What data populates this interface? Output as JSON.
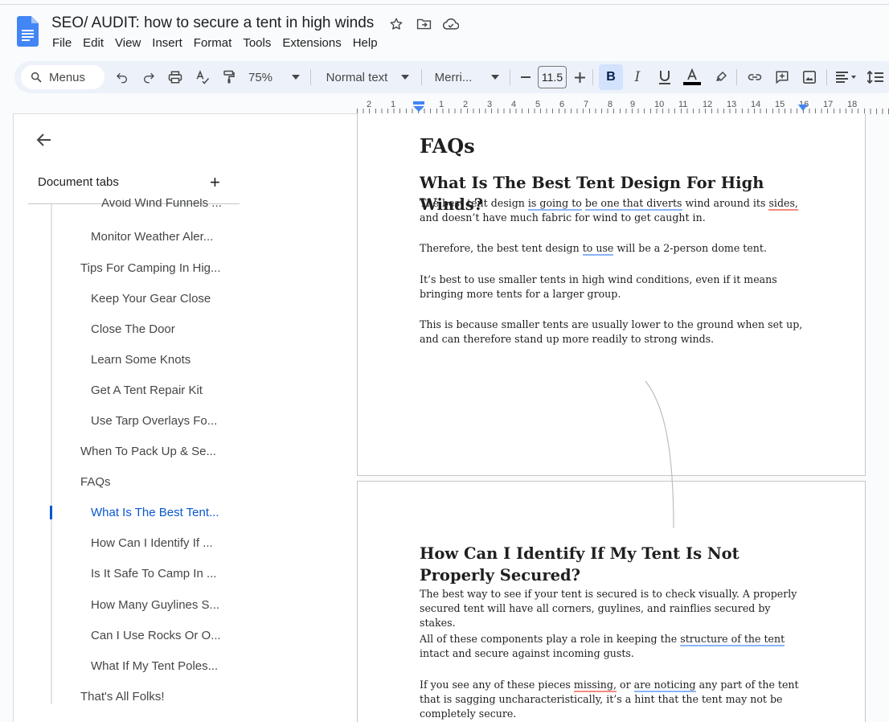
{
  "doc": {
    "title": "SEO/ AUDIT: how to secure a tent in high winds",
    "menus": [
      "File",
      "Edit",
      "View",
      "Insert",
      "Format",
      "Tools",
      "Extensions",
      "Help"
    ]
  },
  "toolbar": {
    "search_label": "Menus",
    "zoom": "75%",
    "style": "Normal text",
    "font": "Merri...",
    "font_size": "11.5"
  },
  "ruler": {
    "marks": [
      "2",
      "1",
      "1",
      "2",
      "3",
      "4",
      "5",
      "6",
      "7",
      "8",
      "9",
      "10",
      "11",
      "12",
      "13",
      "14",
      "15",
      "16",
      "17",
      "18"
    ]
  },
  "sidebar": {
    "tabs_label": "Document tabs",
    "items": [
      {
        "label": "Avoid Wind Funnels ...",
        "level": "h4"
      },
      {
        "label": "Monitor Weather Aler...",
        "level": "h3"
      },
      {
        "label": "Tips For Camping In Hig...",
        "level": "h2"
      },
      {
        "label": "Keep Your Gear Close",
        "level": "h3"
      },
      {
        "label": "Close The Door",
        "level": "h3"
      },
      {
        "label": "Learn Some Knots",
        "level": "h3"
      },
      {
        "label": "Get A Tent Repair Kit",
        "level": "h3"
      },
      {
        "label": "Use Tarp Overlays Fo...",
        "level": "h3"
      },
      {
        "label": "When To Pack Up & Se...",
        "level": "h2"
      },
      {
        "label": "FAQs",
        "level": "h2"
      },
      {
        "label": "What Is The Best Tent...",
        "level": "h3",
        "active": true
      },
      {
        "label": "How Can I Identify If ...",
        "level": "h3"
      },
      {
        "label": "Is It Safe To Camp In ...",
        "level": "h3"
      },
      {
        "label": "How Many Guylines S...",
        "level": "h3"
      },
      {
        "label": "Can I Use Rocks Or O...",
        "level": "h3"
      },
      {
        "label": "What If My Tent Poles...",
        "level": "h3"
      },
      {
        "label": "That's All Folks!",
        "level": "h2"
      }
    ]
  },
  "page1": {
    "heading": "FAQs",
    "q1": "What Is The Best Tent Design For High Winds?",
    "p1": {
      "a": "The best tent design ",
      "b": "is going to",
      "c": " ",
      "d": "be one that diverts",
      "e": " wind around its ",
      "f": "sides,",
      "g": " and doesn’t have much fabric for wind to get caught in."
    },
    "p2": {
      "a": "Therefore, the best tent design ",
      "b": "to use",
      "c": " will be a 2-person dome tent."
    },
    "p3": "It’s best to use smaller tents in high wind conditions, even if it means bringing more tents for a larger group.",
    "p4": "This is because smaller tents are usually lower to the ground when set up, and can therefore stand up more readily to strong winds."
  },
  "page2": {
    "q2": "How Can I Identify If My Tent Is Not Properly Secured?",
    "p1": "The best way to see if your tent is secured is to check visually. A properly secured tent will have all corners, guylines, and rainflies secured by stakes.",
    "p2": {
      "a": "All of these components play a role in keeping the ",
      "b": "structure of the tent",
      "c": " intact and secure against incoming gusts."
    },
    "p3": {
      "a": "If you see any of these pieces ",
      "b": "missing,",
      "c": " or ",
      "d": "are noticing",
      "e": " any part of the tent that is sagging uncharacteristically, it’s a hint that the tent may not be completely secure."
    }
  }
}
